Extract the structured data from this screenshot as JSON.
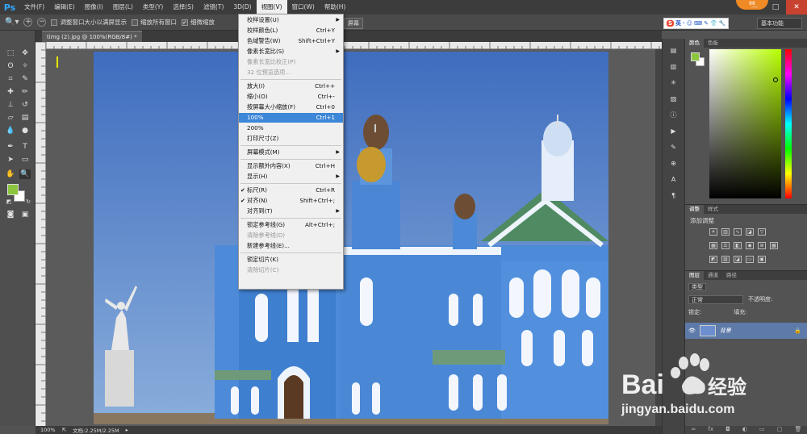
{
  "menubar": {
    "logo": "Ps",
    "items": [
      "文件(F)",
      "编辑(E)",
      "图像(I)",
      "图层(L)",
      "类型(Y)",
      "选择(S)",
      "滤镜(T)",
      "3D(D)",
      "视图(V)",
      "窗口(W)",
      "帮助(H)"
    ],
    "active_index": 8,
    "badge": "88",
    "window_controls": [
      "—",
      "□",
      "✕"
    ]
  },
  "options_bar": {
    "zoom_in_icon": "zoom-in-icon",
    "checkbox1": "调整窗口大小以满屏显示",
    "checkbox2": "缩放所有窗口",
    "checkbox3": "细微缩放",
    "button_partial": "屏幕",
    "workspace": "基本功能",
    "ime": {
      "logo": "S",
      "items": [
        "英",
        "·",
        "☺",
        "⌨",
        "✎",
        "👕",
        "🔧"
      ]
    }
  },
  "document": {
    "tab_title": "timg (2).jpg @ 100%(RGB/8#) *",
    "zoom": "100%",
    "doc_size": "文档:2.25M/2.25M"
  },
  "view_menu": {
    "items": [
      {
        "label": "校样设置(U)",
        "shortcut": "",
        "submenu": true,
        "disabled": false
      },
      {
        "label": "校样颜色(L)",
        "shortcut": "Ctrl+Y",
        "submenu": false,
        "disabled": false
      },
      {
        "label": "色域警告(W)",
        "shortcut": "Shift+Ctrl+Y",
        "submenu": false,
        "disabled": false
      },
      {
        "label": "像素长宽比(S)",
        "shortcut": "",
        "submenu": true,
        "disabled": false
      },
      {
        "label": "像素长宽比校正(P)",
        "shortcut": "",
        "submenu": false,
        "disabled": true
      },
      {
        "label": "32 位预览选项...",
        "shortcut": "",
        "submenu": false,
        "disabled": true
      },
      {
        "label": "放大(I)",
        "shortcut": "Ctrl++",
        "submenu": false,
        "disabled": false
      },
      {
        "label": "缩小(O)",
        "shortcut": "Ctrl+-",
        "submenu": false,
        "disabled": false
      },
      {
        "label": "按屏幕大小缩放(F)",
        "shortcut": "Ctrl+0",
        "submenu": false,
        "disabled": false
      },
      {
        "label": "100%",
        "shortcut": "Ctrl+1",
        "submenu": false,
        "disabled": false,
        "highlighted": true
      },
      {
        "label": "200%",
        "shortcut": "",
        "submenu": false,
        "disabled": false
      },
      {
        "label": "打印尺寸(Z)",
        "shortcut": "",
        "submenu": false,
        "disabled": false
      },
      {
        "label": "屏幕模式(M)",
        "shortcut": "",
        "submenu": true,
        "disabled": false
      },
      {
        "label": "显示额外内容(X)",
        "shortcut": "Ctrl+H",
        "submenu": false,
        "disabled": false
      },
      {
        "label": "显示(H)",
        "shortcut": "",
        "submenu": true,
        "disabled": false
      },
      {
        "label": "标尺(R)",
        "shortcut": "Ctrl+R",
        "submenu": false,
        "disabled": false,
        "checked": true
      },
      {
        "label": "对齐(N)",
        "shortcut": "Shift+Ctrl+;",
        "submenu": false,
        "disabled": false,
        "checked": true
      },
      {
        "label": "对齐到(T)",
        "shortcut": "",
        "submenu": true,
        "disabled": false
      },
      {
        "label": "锁定参考线(G)",
        "shortcut": "Alt+Ctrl+;",
        "submenu": false,
        "disabled": false
      },
      {
        "label": "清除参考线(D)",
        "shortcut": "",
        "submenu": false,
        "disabled": true
      },
      {
        "label": "新建参考线(E)...",
        "shortcut": "",
        "submenu": false,
        "disabled": false
      },
      {
        "label": "锁定切片(K)",
        "shortcut": "",
        "submenu": false,
        "disabled": false
      },
      {
        "label": "清除切片(C)",
        "shortcut": "",
        "submenu": false,
        "disabled": true
      }
    ]
  },
  "color_panel": {
    "tabs": [
      "颜色",
      "色板"
    ],
    "foreground": "#8cc63e",
    "background": "#ffffff"
  },
  "adjust_panel": {
    "tabs": [
      "调整",
      "样式"
    ],
    "title": "添加调整"
  },
  "layers_panel": {
    "tabs": [
      "图层",
      "通道",
      "路径"
    ],
    "filter": "类型",
    "blend_mode": "正常",
    "opacity_label": "不透明度:",
    "lock_label": "锁定:",
    "fill_label": "填充:",
    "layer_name": "背景",
    "footer_icons": [
      "link-icon",
      "fx-icon",
      "mask-icon",
      "adjust-icon",
      "folder-icon",
      "new-layer-icon",
      "trash-icon"
    ]
  },
  "watermark": {
    "brand": "Bai",
    "brand2": "经验",
    "url": "jingyan.baidu.com"
  }
}
